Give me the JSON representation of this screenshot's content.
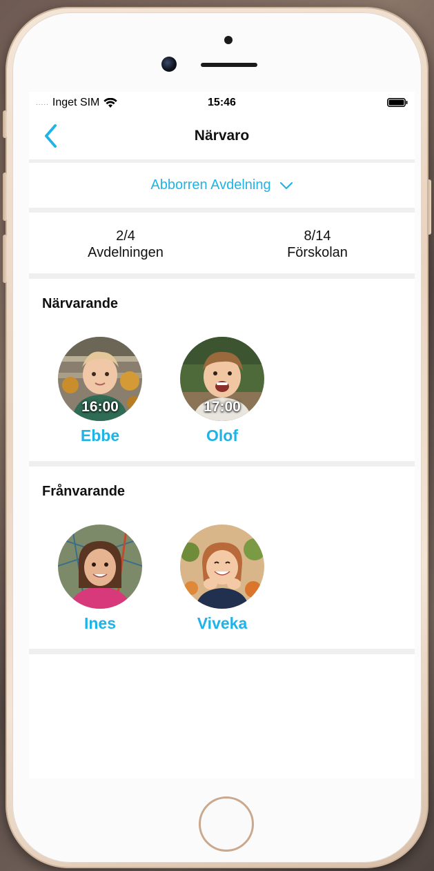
{
  "status_bar": {
    "carrier": "Inget SIM",
    "signal_dots": ".....",
    "time": "15:46"
  },
  "nav": {
    "title": "Närvaro"
  },
  "department": {
    "label": "Abborren Avdelning"
  },
  "stats": {
    "department": {
      "value": "2/4",
      "label": "Avdelningen"
    },
    "preschool": {
      "value": "8/14",
      "label": "Förskolan"
    }
  },
  "present": {
    "title": "Närvarande",
    "children": [
      {
        "name": "Ebbe",
        "time": "16:00"
      },
      {
        "name": "Olof",
        "time": "17:00"
      }
    ]
  },
  "absent": {
    "title": "Frånvarande",
    "children": [
      {
        "name": "Ines"
      },
      {
        "name": "Viveka"
      }
    ]
  },
  "colors": {
    "accent": "#1fb3e6",
    "background": "#efefef",
    "card": "#ffffff"
  }
}
